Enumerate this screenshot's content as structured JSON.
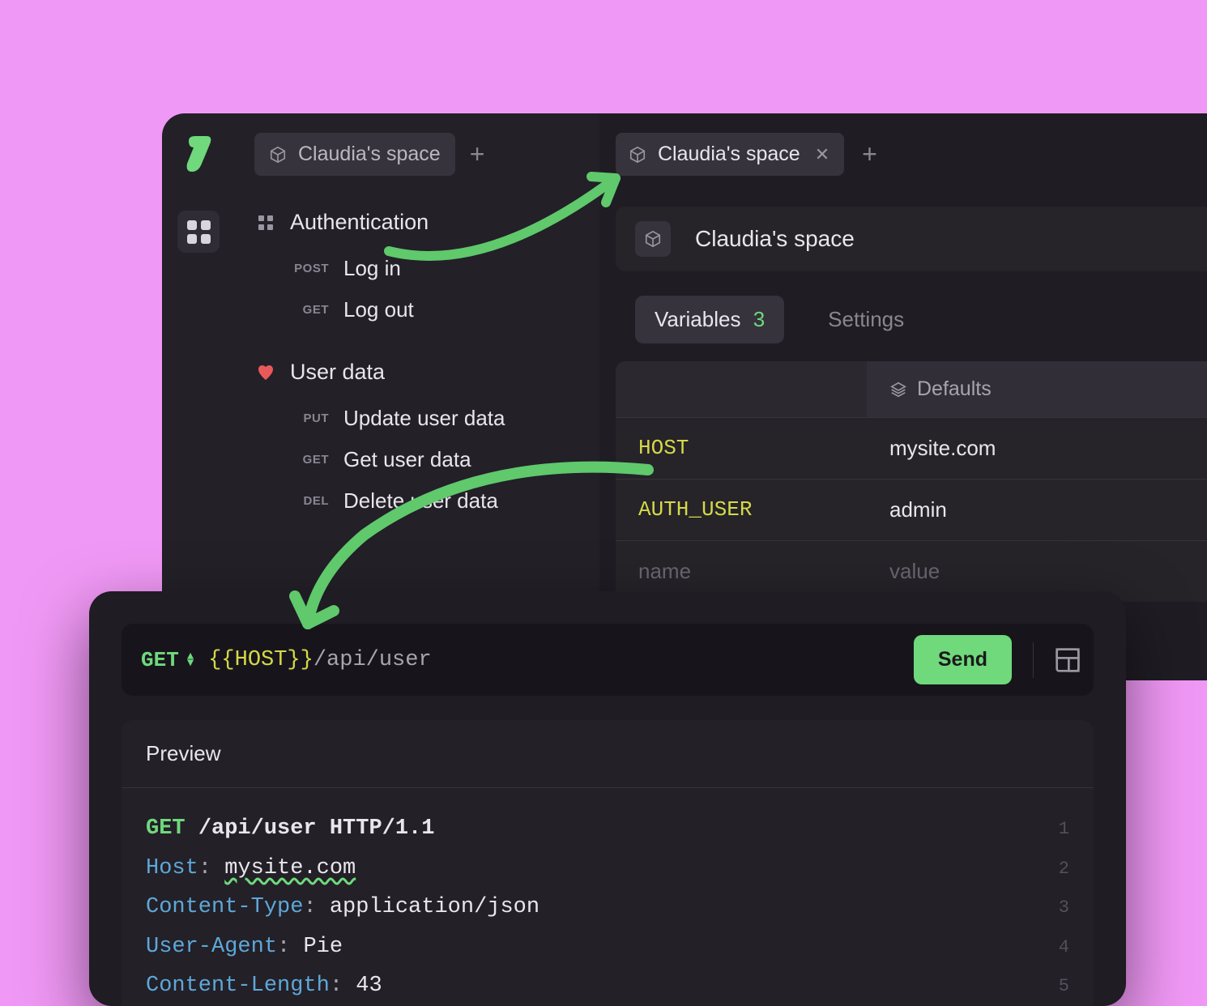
{
  "sidebar": {
    "workspace_tab": "Claudia's space",
    "groups": [
      {
        "icon": "grid",
        "label": "Authentication",
        "items": [
          {
            "method": "POST",
            "label": "Log in"
          },
          {
            "method": "GET",
            "label": "Log out"
          }
        ]
      },
      {
        "icon": "heart",
        "label": "User data",
        "items": [
          {
            "method": "PUT",
            "label": "Update user data"
          },
          {
            "method": "GET",
            "label": "Get user data"
          },
          {
            "method": "DEL",
            "label": "Delete user data"
          }
        ]
      }
    ]
  },
  "main": {
    "tab_label": "Claudia's space",
    "space_title": "Claudia's space",
    "sub_tabs": {
      "variables_label": "Variables",
      "variables_count": "3",
      "settings_label": "Settings"
    },
    "vars_table": {
      "defaults_label": "Defaults",
      "rows": [
        {
          "key": "HOST",
          "value": "mysite.com"
        },
        {
          "key": "AUTH_USER",
          "value": "admin"
        }
      ],
      "placeholder": {
        "key": "name",
        "value": "value"
      }
    }
  },
  "request": {
    "method": "GET",
    "url_var": "{{HOST}}",
    "url_path": "/api/user",
    "send_label": "Send",
    "preview_label": "Preview",
    "lines": [
      {
        "num": "1",
        "method": "GET",
        "path": "/api/user",
        "proto": "HTTP/1.1"
      },
      {
        "num": "2",
        "header": "Host",
        "value": "mysite.com",
        "highlight": true
      },
      {
        "num": "3",
        "header": "Content-Type",
        "value": "application/json"
      },
      {
        "num": "4",
        "header": "User-Agent",
        "value": "Pie"
      },
      {
        "num": "5",
        "header": "Content-Length",
        "value": "43"
      }
    ]
  },
  "colors": {
    "accent": "#6fd97c",
    "var": "#d5d948",
    "bg": "#1f1c24"
  }
}
